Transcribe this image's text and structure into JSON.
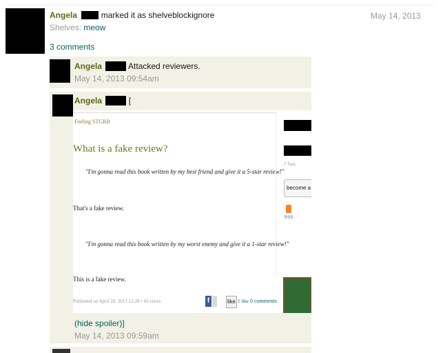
{
  "activity": {
    "user_name": "Angela",
    "action_text": "marked it as shelveblockignore",
    "date": "May 14, 2013",
    "shelves_label": "Shelves:",
    "shelf_name": "meow",
    "comments_count": "3 comments"
  },
  "comments": [
    {
      "user_name": "Angela",
      "text": "Attacked reviewers.",
      "timestamp": "May 14, 2013 09:54am"
    },
    {
      "user_name": "Angela",
      "text": "[",
      "spoiler_close": "(hide spoiler)]",
      "timestamp": "May 14, 2013 09:59am"
    }
  ],
  "embedded_blog": {
    "blog_title": "Feeling STGRB",
    "post_title": "What is a fake review?",
    "quote1": "\"I'm gonna read this book written by my best friend and give it a 5-star review!\"",
    "statement1": "That's a fake review.",
    "quote2": "\"I'm gonna read this book written by my worst enemy and give it a 1-star review!\"",
    "statement2": "This is a fake review.",
    "published_text": "Published on April 28, 2013 12:28 • 43 views",
    "like_button": "like",
    "like_count": "1 like",
    "comments_link": "0 comments",
    "fans_text": "7 fans",
    "become_fan": "become a fan",
    "rss_label": "RSS"
  }
}
